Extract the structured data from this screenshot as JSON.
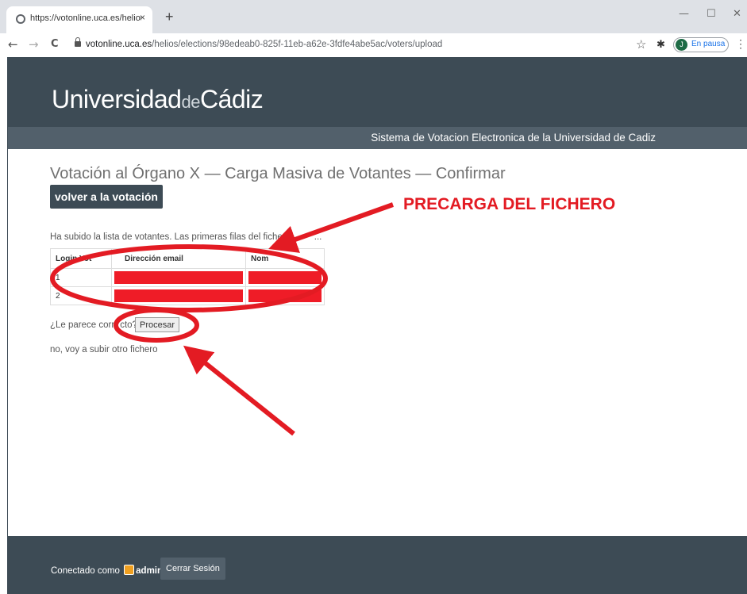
{
  "browser": {
    "tab_title": "https://votonline.uca.es/helios/e",
    "tab_close": "×",
    "new_tab": "+",
    "url_host": "votonline.uca.es",
    "url_path": "/helios/elections/98edeab0-825f-11eb-a62e-3fdfe4abe5ac/voters/upload",
    "profile_initial": "J",
    "profile_label": "En pausa",
    "back": "←",
    "forward": "→",
    "reload": "C",
    "star": "☆",
    "extensions": "✱",
    "menu": "⋮",
    "minimize": "—",
    "maximize": "☐",
    "close": "✕"
  },
  "header": {
    "brand_a": "Universidad",
    "brand_de": "de",
    "brand_b": "Cádiz",
    "subtitle": "Sistema de Votacion Electronica de la Universidad de Cadiz"
  },
  "main": {
    "title": "Votación al Órgano X — Carga Masiva de Votantes — Confirmar",
    "back_button": "volver a la votación",
    "intro": "Ha subido la lista de votantes. Las primeras filas del fiche",
    "intro_tail": "...",
    "columns": [
      "Login Vot",
      "Dirección email",
      "Nom"
    ],
    "rows": [
      {
        "login": "1"
      },
      {
        "login": "2"
      }
    ],
    "confirm_text": "¿Le parece corr",
    "confirm_tail": "cto?",
    "process_button": "Procesar",
    "other_file": "no, voy a subir otro fichero"
  },
  "annotation": {
    "label": "PRECARGA DEL FICHERO",
    "color": "#e31b23"
  },
  "footer": {
    "connected_as": "Conectado como",
    "user": "admin",
    "logout": "Cerrar Sesión"
  },
  "colors": {
    "header_bg": "#3d4b55",
    "subbar_bg": "#52606b",
    "redaction": "#ef1c27"
  }
}
